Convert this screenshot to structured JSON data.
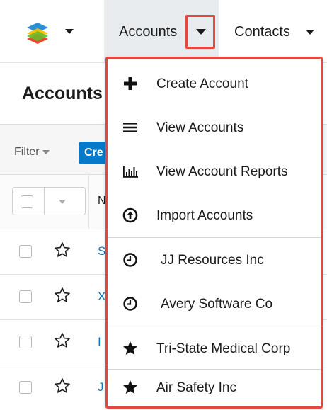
{
  "nav": {
    "logo_icon": "sugar-cube-logo",
    "accounts_label": "Accounts",
    "contacts_label": "Contacts"
  },
  "page": {
    "title": "Accounts"
  },
  "filter_bar": {
    "filter_label": "Filter",
    "create_label": "Cre"
  },
  "table": {
    "header_partial": "N",
    "rows": [
      {
        "name_partial": "S"
      },
      {
        "name_partial": "X"
      },
      {
        "name_partial": "I"
      },
      {
        "name_partial": "J"
      }
    ]
  },
  "dropdown": {
    "actions": [
      {
        "label": "Create Account",
        "icon": "plus-icon"
      },
      {
        "label": "View Accounts",
        "icon": "list-icon"
      },
      {
        "label": "View Account Reports",
        "icon": "bar-chart-icon"
      },
      {
        "label": "Import Accounts",
        "icon": "upload-circle-icon"
      }
    ],
    "recents": [
      {
        "label": "JJ Resources Inc",
        "icon": "clock-icon"
      },
      {
        "label": "Avery Software Co",
        "icon": "clock-icon"
      }
    ],
    "favorites": [
      {
        "label": "Tri-State Medical Corp",
        "icon": "star-filled-icon"
      },
      {
        "label": "Air Safety Inc",
        "icon": "star-filled-icon"
      }
    ]
  },
  "colors": {
    "accent_blue": "#0679c8",
    "highlight_red": "#e2483f",
    "active_nav_bg": "#e9ecef"
  }
}
